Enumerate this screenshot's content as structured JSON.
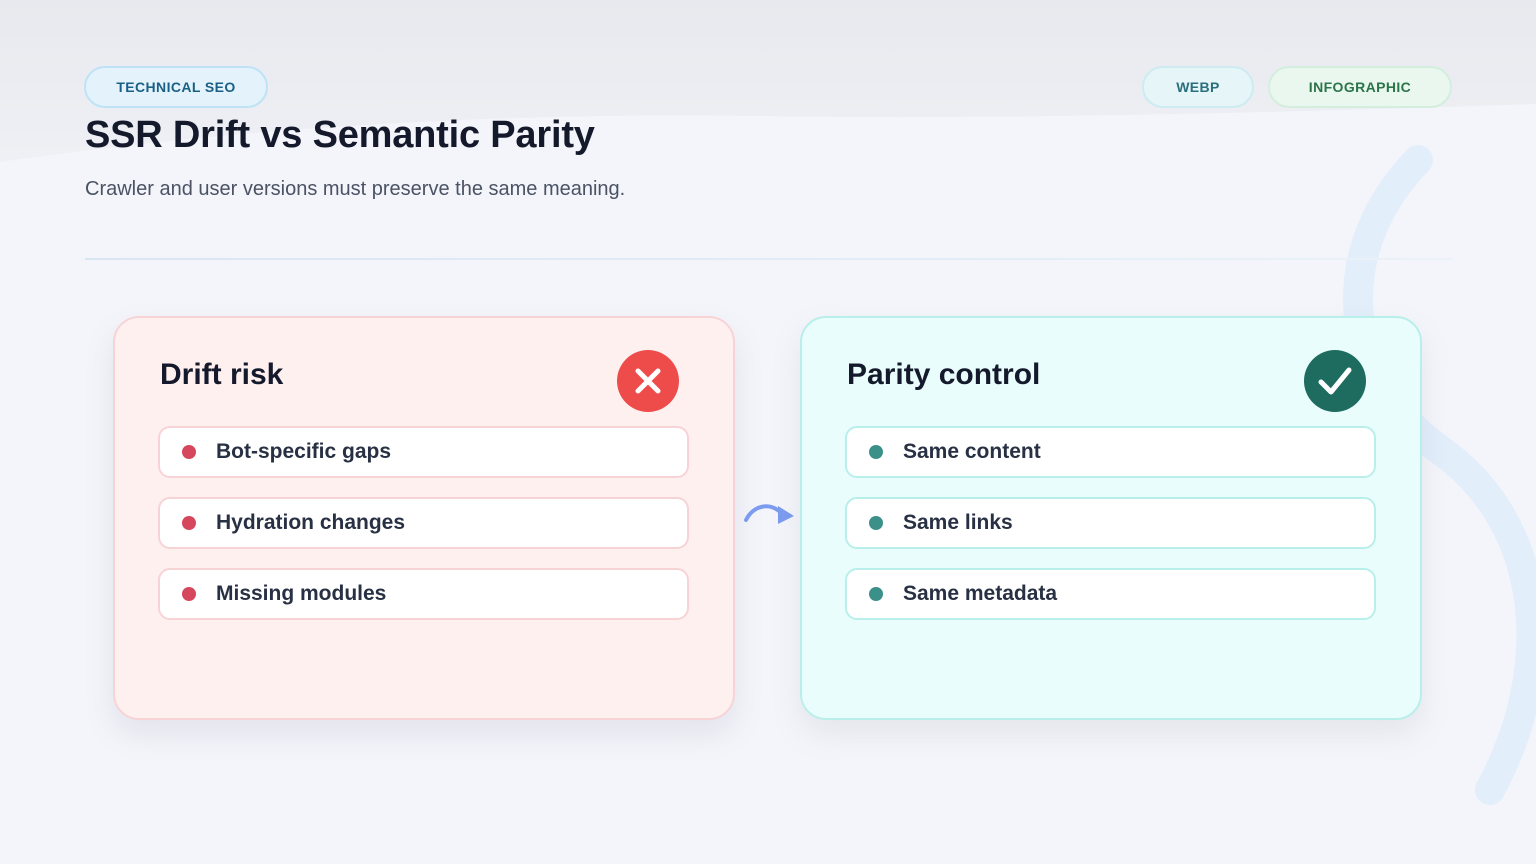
{
  "tags": {
    "category": "TECHNICAL SEO",
    "format": "WEBP",
    "type": "INFOGRAPHIC"
  },
  "header": {
    "title": "SSR Drift vs Semantic Parity",
    "subtitle": "Crawler and user versions must preserve the same meaning."
  },
  "drift": {
    "title": "Drift risk",
    "icon": "x-circle-icon",
    "color": "#ee4b4b",
    "items": [
      {
        "label": "Bot-specific gaps"
      },
      {
        "label": "Hydration changes"
      },
      {
        "label": "Missing modules"
      }
    ]
  },
  "parity": {
    "title": "Parity control",
    "icon": "check-circle-icon",
    "color": "#1e6b60",
    "items": [
      {
        "label": "Same content"
      },
      {
        "label": "Same links"
      },
      {
        "label": "Same metadata"
      }
    ]
  },
  "connector": {
    "icon": "curved-arrow-right-icon",
    "color": "#7b9cf0"
  }
}
